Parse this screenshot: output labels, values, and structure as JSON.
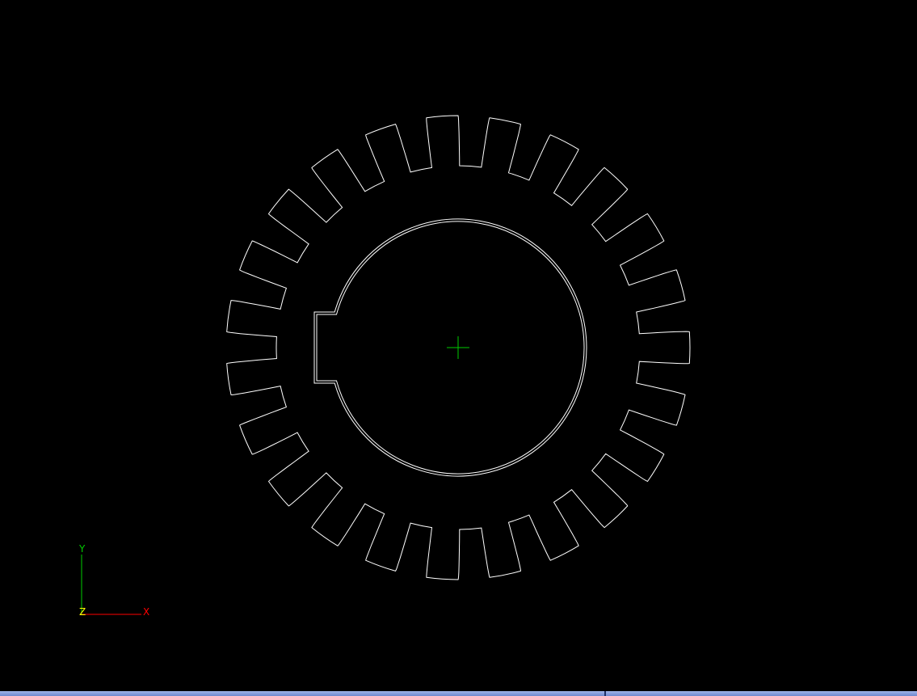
{
  "viewport": {
    "background": "#000000",
    "drawing": {
      "object": "spur-gear",
      "tooth_count": 23,
      "has_bore": true,
      "has_keyway": true,
      "outline_color": "#ffffff",
      "center_mark_color": "#00cc00"
    },
    "axis_triad": {
      "x_label": "X",
      "y_label": "Y",
      "z_label": "Z",
      "x_color": "#ff0000",
      "y_color": "#00cc00",
      "z_color": "#ffff00"
    }
  },
  "status_strip": {
    "color": "#8aa2e0"
  }
}
